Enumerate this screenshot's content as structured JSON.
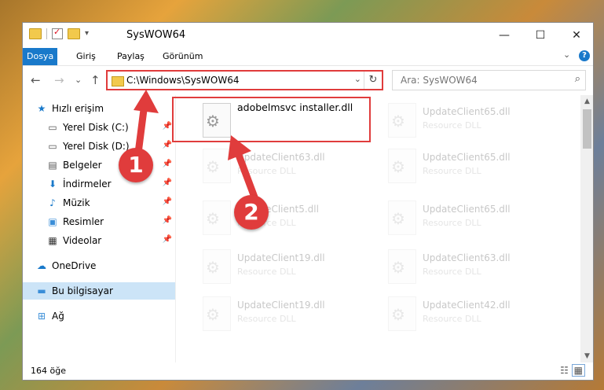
{
  "window": {
    "title": "SysWOW64",
    "minimize": "—",
    "maximize": "☐",
    "close": "✕"
  },
  "ribbon": {
    "tabs": [
      "Dosya",
      "Giriş",
      "Paylaş",
      "Görünüm"
    ],
    "help": "?",
    "collapse": "⌄",
    "accent": "#1979ca"
  },
  "nav": {
    "back": "←",
    "forward": "→",
    "recent": "⌄",
    "up": "↑",
    "address": "C:\\Windows\\SysWOW64",
    "address_dropdown": "⌄",
    "refresh": "↻",
    "search_placeholder": "Ara: SysWOW64",
    "search_icon": "⌕"
  },
  "sidebar": {
    "items": [
      {
        "label": "Hızlı erişim",
        "icon": "star-icon",
        "glyph": "★",
        "pinned": false
      },
      {
        "label": "Yerel Disk (C:)",
        "icon": "drive-icon",
        "glyph": "▭",
        "pinned": true
      },
      {
        "label": "Yerel Disk (D:)",
        "icon": "drive-icon",
        "glyph": "▭",
        "pinned": true
      },
      {
        "label": "Belgeler",
        "icon": "document-icon",
        "glyph": "▤",
        "pinned": true
      },
      {
        "label": "İndirmeler",
        "icon": "download-icon",
        "glyph": "⬇",
        "pinned": true
      },
      {
        "label": "Müzik",
        "icon": "music-icon",
        "glyph": "♪",
        "pinned": true
      },
      {
        "label": "Resimler",
        "icon": "pictures-icon",
        "glyph": "▣",
        "pinned": true
      },
      {
        "label": "Videolar",
        "icon": "video-icon",
        "glyph": "▦",
        "pinned": true
      },
      {
        "label": "OneDrive",
        "icon": "cloud-icon",
        "glyph": "☁",
        "pinned": false
      },
      {
        "label": "Bu bilgisayar",
        "icon": "computer-icon",
        "glyph": "▬",
        "pinned": false,
        "selected": true
      },
      {
        "label": "Ağ",
        "icon": "network-icon",
        "glyph": "⊞",
        "pinned": false
      }
    ],
    "pin_glyph": "📌"
  },
  "files": [
    {
      "name": "adobelmsvc installer.dll",
      "type": ""
    },
    {
      "name": "UpdateClient65.dll",
      "type": "Resource DLL"
    },
    {
      "name": "UpdateClient63.dll",
      "type": "Resource DLL"
    },
    {
      "name": "UpdateClient65.dll",
      "type": "Resource DLL"
    },
    {
      "name": "UpdateClient5.dll",
      "type": "Resource DLL"
    },
    {
      "name": "UpdateClient65.dll",
      "type": "Resource DLL"
    },
    {
      "name": "UpdateClient19.dll",
      "type": "Resource DLL"
    },
    {
      "name": "UpdateClient63.dll",
      "type": "Resource DLL"
    },
    {
      "name": "UpdateClient19.dll",
      "type": "Resource DLL"
    },
    {
      "name": "UpdateClient42.dll",
      "type": "Resource DLL"
    }
  ],
  "status": {
    "count": "164 öğe"
  },
  "callouts": [
    "1",
    "2"
  ],
  "colors": {
    "highlight": "#e03c3c",
    "selected_bg": "#cce4f7"
  }
}
